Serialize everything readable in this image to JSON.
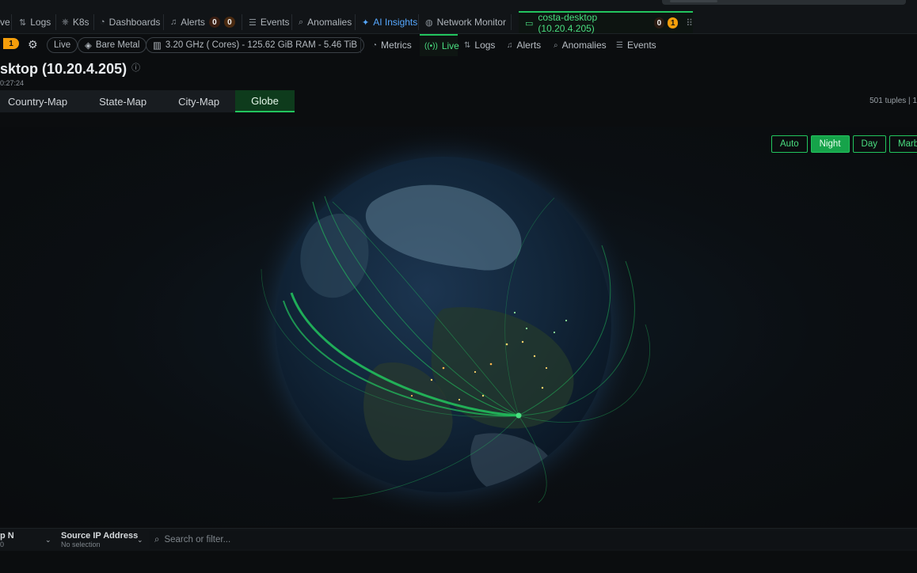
{
  "top_tabs": [
    {
      "label": "ve"
    },
    {
      "label": "Logs",
      "icon": "logs-icon"
    },
    {
      "label": "K8s",
      "icon": "k8s-icon"
    },
    {
      "label": "Dashboards",
      "icon": "dashboard-icon"
    },
    {
      "label": "Alerts",
      "icon": "bell-icon",
      "count_a": "0",
      "count_b": "0"
    },
    {
      "label": "Events",
      "icon": "events-icon"
    },
    {
      "label": "Anomalies",
      "icon": "anomaly-icon"
    },
    {
      "label": "AI Insights",
      "icon": "sparkle-icon"
    },
    {
      "label": "Network Monitor",
      "icon": "network-icon"
    }
  ],
  "host_tab": {
    "label": "costa-desktop (10.20.4.205)",
    "count_a": "0",
    "count_b": "1"
  },
  "subbar": {
    "left_badge": "1",
    "live_pill": "Live",
    "bare_metal": "Bare Metal",
    "specs": "3.20 GHz ( Cores) - 125.62 GiB RAM - 5.46 TiB",
    "tabs": [
      "Metrics",
      "Live",
      "Logs",
      "Alerts",
      "Anomalies",
      "Events"
    ]
  },
  "page": {
    "title": "sktop (10.20.4.205)",
    "subtitle": "0:27:24"
  },
  "map_tabs": [
    "Country-Map",
    "State-Map",
    "City-Map",
    "Globe"
  ],
  "tuples": "501 tuples | 1",
  "modes": [
    "Auto",
    "Night",
    "Day",
    "Marble"
  ],
  "filters": {
    "topn_label": "p N",
    "topn_value": "0",
    "source_label": "Source IP Address",
    "source_value": "No selection",
    "search_placeholder": "Search or filter..."
  },
  "colors": {
    "accent": "#22c55e",
    "accent_bg": "#16a34a",
    "link": "#56a8ff",
    "badge_orange": "#f59e0b"
  }
}
